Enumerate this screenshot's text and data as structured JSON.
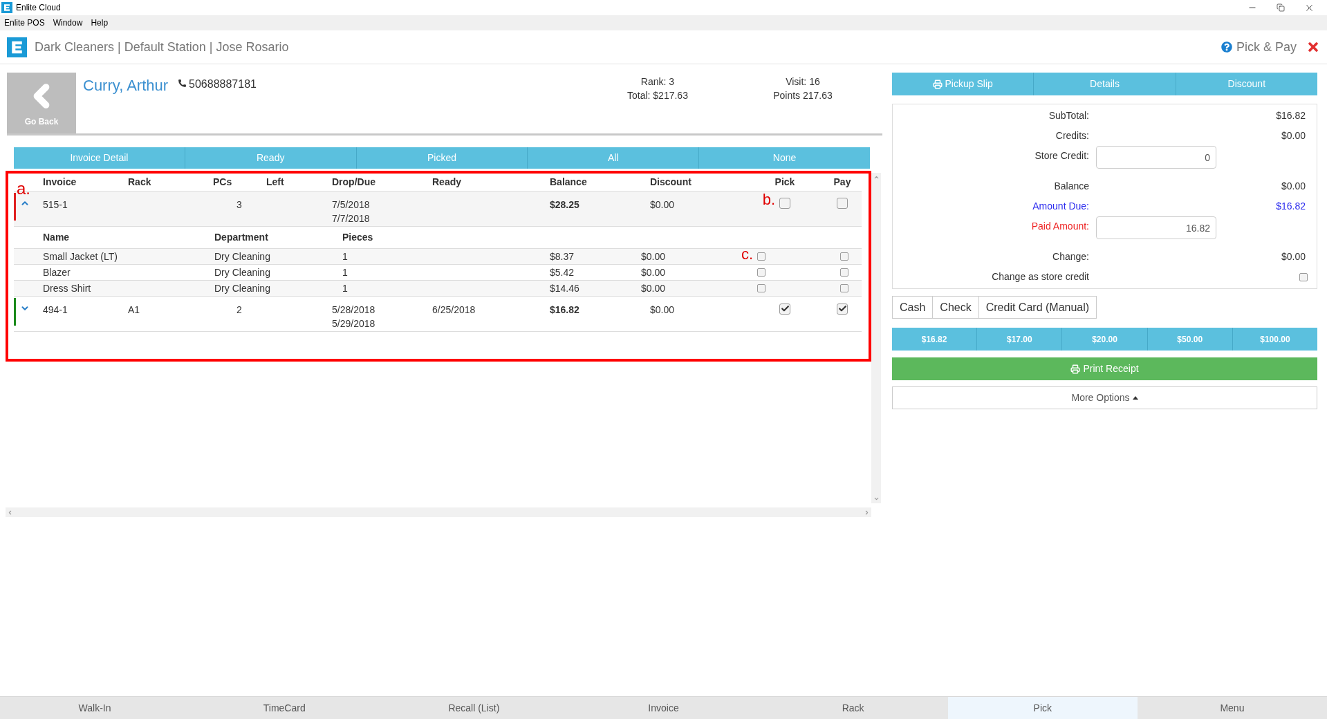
{
  "window": {
    "title": "Enlite Cloud"
  },
  "menu": [
    "Enlite POS",
    "Window",
    "Help"
  ],
  "header": {
    "title": "Dark Cleaners | Default Station | Jose Rosario",
    "page_title": "Pick & Pay"
  },
  "customer": {
    "back_label": "Go Back",
    "name": "Curry, Arthur",
    "phone": "50688887181",
    "rank": "Rank: 3",
    "total": "Total: $217.63",
    "visit": "Visit: 16",
    "points": "Points 217.63"
  },
  "filter_buttons": [
    "Invoice Detail",
    "Ready",
    "Picked",
    "All",
    "None"
  ],
  "table": {
    "annotation": "a.",
    "columns": [
      "Invoice",
      "Rack",
      "PCs",
      "Left",
      "Drop/Due",
      "Ready",
      "Balance",
      "Discount",
      "Pick",
      "Pay"
    ],
    "item_columns": [
      "Name",
      "Department",
      "Pieces"
    ],
    "invoices": [
      {
        "invoice": "515-1",
        "pcs": "3",
        "drop": "7/5/2018",
        "due": "7/7/2018",
        "balance": "$28.25",
        "discount": "$0.00",
        "pick": false,
        "pay": false,
        "expanded": true,
        "color": "#e02020",
        "annotation": "b.",
        "items": [
          {
            "name": "Small Jacket (LT)",
            "department": "Dry Cleaning",
            "pieces": "1",
            "balance": "$8.37",
            "discount": "$0.00",
            "pick": false,
            "pay": false,
            "annotation": "c."
          },
          {
            "name": "Blazer",
            "department": "Dry Cleaning",
            "pieces": "1",
            "balance": "$5.42",
            "discount": "$0.00",
            "pick": false,
            "pay": false
          },
          {
            "name": "Dress Shirt",
            "department": "Dry Cleaning",
            "pieces": "1",
            "balance": "$14.46",
            "discount": "$0.00",
            "pick": false,
            "pay": false
          }
        ]
      },
      {
        "invoice": "494-1",
        "rack": "A1",
        "pcs": "2",
        "drop": "5/28/2018",
        "due": "5/29/2018",
        "ready": "6/25/2018",
        "balance": "$16.82",
        "discount": "$0.00",
        "pick": true,
        "pay": true,
        "expanded": false,
        "color": "#1a8a1a"
      }
    ]
  },
  "side_buttons": [
    "Pickup Slip",
    "Details",
    "Discount"
  ],
  "summary": [
    {
      "kind": "value",
      "label": "SubTotal:",
      "value": "$16.82"
    },
    {
      "kind": "value",
      "label": "Credits:",
      "value": "$0.00"
    },
    {
      "kind": "input",
      "label": "Store Credit:",
      "value": "0"
    },
    {
      "kind": "value",
      "label": "Balance",
      "value": "$0.00"
    },
    {
      "kind": "value",
      "label": "Amount Due:",
      "value": "$16.82",
      "color": "#2a2aee"
    },
    {
      "kind": "input",
      "label": "Paid Amount:",
      "value": "16.82",
      "color": "#ee2222"
    },
    {
      "kind": "value",
      "label": "Change:",
      "value": "$0.00"
    },
    {
      "kind": "checkbox",
      "label": "Change as store credit",
      "checked": false
    }
  ],
  "payment_methods": [
    "Cash",
    "Check",
    "Credit Card (Manual)"
  ],
  "quick_amounts": [
    "$16.82",
    "$17.00",
    "$20.00",
    "$50.00",
    "$100.00"
  ],
  "print_button": "Print Receipt",
  "more_options": "More Options",
  "bottom_nav": [
    {
      "label": "Walk-In",
      "selected": false
    },
    {
      "label": "TimeCard",
      "selected": false
    },
    {
      "label": "Recall (List)",
      "selected": false
    },
    {
      "label": "Invoice",
      "selected": false
    },
    {
      "label": "Rack",
      "selected": false
    },
    {
      "label": "Pick",
      "selected": true
    },
    {
      "label": "Menu",
      "selected": false
    }
  ]
}
